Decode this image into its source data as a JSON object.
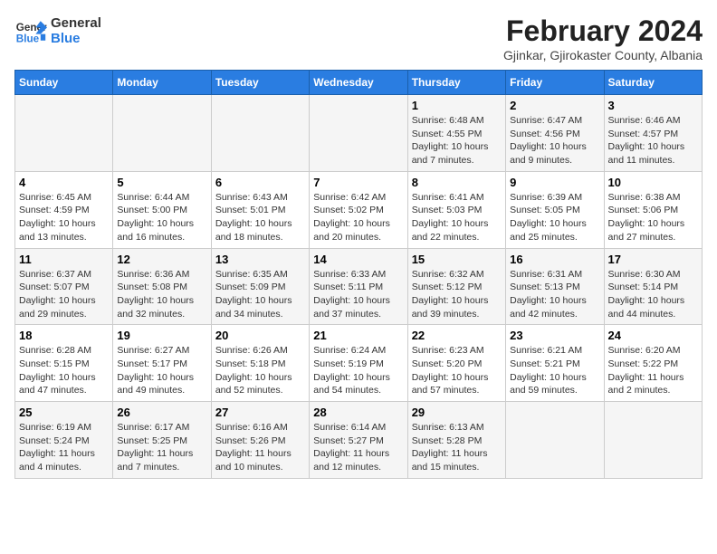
{
  "logo": {
    "line1": "General",
    "line2": "Blue"
  },
  "title": "February 2024",
  "subtitle": "Gjinkar, Gjirokaster County, Albania",
  "weekdays": [
    "Sunday",
    "Monday",
    "Tuesday",
    "Wednesday",
    "Thursday",
    "Friday",
    "Saturday"
  ],
  "rows": [
    [
      {
        "day": "",
        "info": ""
      },
      {
        "day": "",
        "info": ""
      },
      {
        "day": "",
        "info": ""
      },
      {
        "day": "",
        "info": ""
      },
      {
        "day": "1",
        "info": "Sunrise: 6:48 AM\nSunset: 4:55 PM\nDaylight: 10 hours\nand 7 minutes."
      },
      {
        "day": "2",
        "info": "Sunrise: 6:47 AM\nSunset: 4:56 PM\nDaylight: 10 hours\nand 9 minutes."
      },
      {
        "day": "3",
        "info": "Sunrise: 6:46 AM\nSunset: 4:57 PM\nDaylight: 10 hours\nand 11 minutes."
      }
    ],
    [
      {
        "day": "4",
        "info": "Sunrise: 6:45 AM\nSunset: 4:59 PM\nDaylight: 10 hours\nand 13 minutes."
      },
      {
        "day": "5",
        "info": "Sunrise: 6:44 AM\nSunset: 5:00 PM\nDaylight: 10 hours\nand 16 minutes."
      },
      {
        "day": "6",
        "info": "Sunrise: 6:43 AM\nSunset: 5:01 PM\nDaylight: 10 hours\nand 18 minutes."
      },
      {
        "day": "7",
        "info": "Sunrise: 6:42 AM\nSunset: 5:02 PM\nDaylight: 10 hours\nand 20 minutes."
      },
      {
        "day": "8",
        "info": "Sunrise: 6:41 AM\nSunset: 5:03 PM\nDaylight: 10 hours\nand 22 minutes."
      },
      {
        "day": "9",
        "info": "Sunrise: 6:39 AM\nSunset: 5:05 PM\nDaylight: 10 hours\nand 25 minutes."
      },
      {
        "day": "10",
        "info": "Sunrise: 6:38 AM\nSunset: 5:06 PM\nDaylight: 10 hours\nand 27 minutes."
      }
    ],
    [
      {
        "day": "11",
        "info": "Sunrise: 6:37 AM\nSunset: 5:07 PM\nDaylight: 10 hours\nand 29 minutes."
      },
      {
        "day": "12",
        "info": "Sunrise: 6:36 AM\nSunset: 5:08 PM\nDaylight: 10 hours\nand 32 minutes."
      },
      {
        "day": "13",
        "info": "Sunrise: 6:35 AM\nSunset: 5:09 PM\nDaylight: 10 hours\nand 34 minutes."
      },
      {
        "day": "14",
        "info": "Sunrise: 6:33 AM\nSunset: 5:11 PM\nDaylight: 10 hours\nand 37 minutes."
      },
      {
        "day": "15",
        "info": "Sunrise: 6:32 AM\nSunset: 5:12 PM\nDaylight: 10 hours\nand 39 minutes."
      },
      {
        "day": "16",
        "info": "Sunrise: 6:31 AM\nSunset: 5:13 PM\nDaylight: 10 hours\nand 42 minutes."
      },
      {
        "day": "17",
        "info": "Sunrise: 6:30 AM\nSunset: 5:14 PM\nDaylight: 10 hours\nand 44 minutes."
      }
    ],
    [
      {
        "day": "18",
        "info": "Sunrise: 6:28 AM\nSunset: 5:15 PM\nDaylight: 10 hours\nand 47 minutes."
      },
      {
        "day": "19",
        "info": "Sunrise: 6:27 AM\nSunset: 5:17 PM\nDaylight: 10 hours\nand 49 minutes."
      },
      {
        "day": "20",
        "info": "Sunrise: 6:26 AM\nSunset: 5:18 PM\nDaylight: 10 hours\nand 52 minutes."
      },
      {
        "day": "21",
        "info": "Sunrise: 6:24 AM\nSunset: 5:19 PM\nDaylight: 10 hours\nand 54 minutes."
      },
      {
        "day": "22",
        "info": "Sunrise: 6:23 AM\nSunset: 5:20 PM\nDaylight: 10 hours\nand 57 minutes."
      },
      {
        "day": "23",
        "info": "Sunrise: 6:21 AM\nSunset: 5:21 PM\nDaylight: 10 hours\nand 59 minutes."
      },
      {
        "day": "24",
        "info": "Sunrise: 6:20 AM\nSunset: 5:22 PM\nDaylight: 11 hours\nand 2 minutes."
      }
    ],
    [
      {
        "day": "25",
        "info": "Sunrise: 6:19 AM\nSunset: 5:24 PM\nDaylight: 11 hours\nand 4 minutes."
      },
      {
        "day": "26",
        "info": "Sunrise: 6:17 AM\nSunset: 5:25 PM\nDaylight: 11 hours\nand 7 minutes."
      },
      {
        "day": "27",
        "info": "Sunrise: 6:16 AM\nSunset: 5:26 PM\nDaylight: 11 hours\nand 10 minutes."
      },
      {
        "day": "28",
        "info": "Sunrise: 6:14 AM\nSunset: 5:27 PM\nDaylight: 11 hours\nand 12 minutes."
      },
      {
        "day": "29",
        "info": "Sunrise: 6:13 AM\nSunset: 5:28 PM\nDaylight: 11 hours\nand 15 minutes."
      },
      {
        "day": "",
        "info": ""
      },
      {
        "day": "",
        "info": ""
      }
    ]
  ]
}
